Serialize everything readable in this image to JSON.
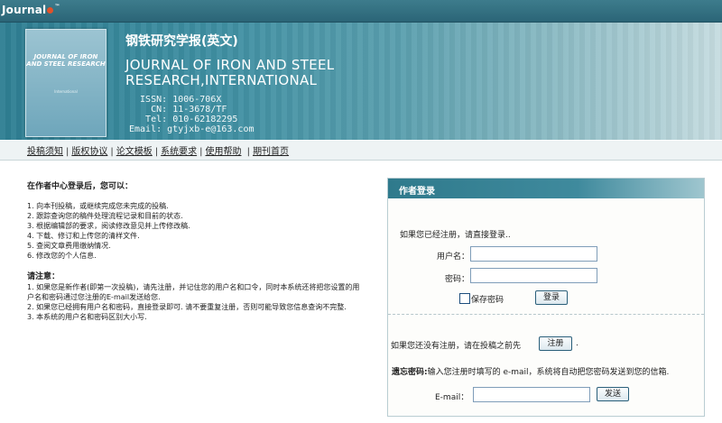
{
  "header": {
    "logo_text": "Journal",
    "logo_tm": "™",
    "title_cn": "钢铁研究学报(英文)",
    "title_en_line1": "JOURNAL OF IRON AND STEEL",
    "title_en_line2": "RESEARCH,INTERNATIONAL",
    "info": [
      {
        "label": "  ISSN:",
        "value": "1006-706X"
      },
      {
        "label": "    CN:",
        "value": "11-3678/TF"
      },
      {
        "label": "   Tel:",
        "value": "010-62182295"
      },
      {
        "label": "Email:",
        "value": "gtyjxb-e@163.com"
      }
    ],
    "cover": {
      "title": "JOURNAL OF IRON AND STEEL RESEARCH",
      "subtitle": "International"
    }
  },
  "nav": {
    "items": [
      "投稿须知",
      "版权协议",
      "论文模板",
      "系统要求",
      "使用帮助",
      "期刊首页"
    ]
  },
  "left": {
    "heading": "在作者中心登录后，您可以：",
    "items": [
      "1. 向本刊投稿，或继续完成您未完成的投稿.",
      "2. 跟踪查询您的稿件处理流程记录和目前的状态.",
      "3. 根据编辑部的要求，阅读修改意见并上传修改稿.",
      "4. 下载、修订和上传您的清样文件.",
      "5. 查阅文章费用缴纳情况.",
      "6. 修改您的个人信息."
    ],
    "note_heading": "请注意：",
    "notes": [
      "1. 如果您是新作者(即第一次投稿)，请先注册，并记住您的用户名和口令，同时本系统还将把您设置的用户名和密码通过您注册的E-mail发送给您.",
      "2. 如果您已经拥有用户名和密码，直接登录即可. 请不要重复注册，否则可能导致您信息查询不完整.",
      "3. 本系统的用户名和密码区别大小写."
    ]
  },
  "login": {
    "title": "作者登录",
    "intro": "如果您已经注册，请直接登录..",
    "username_label": "用户名：",
    "username_value": "",
    "password_label": "密码：",
    "password_value": "",
    "remember_label": "保存密码",
    "login_button": "登录",
    "register_prompt": "如果您还没有注册，请在投稿之前先",
    "register_button": "注册",
    "register_suffix": ".",
    "forgot_label": "遗忘密码:",
    "forgot_text": "输入您注册时填写的 e-mail，系统将自动把您密码发送到您的信箱.",
    "email_label": "E-mail：",
    "email_value": "",
    "send_button": "发送"
  },
  "colors": {
    "header_bar": "#2b6577",
    "banner_teal": "#3f8fa2",
    "panel_head": "#2f7a8c",
    "accent_logo": "#e0522a"
  }
}
